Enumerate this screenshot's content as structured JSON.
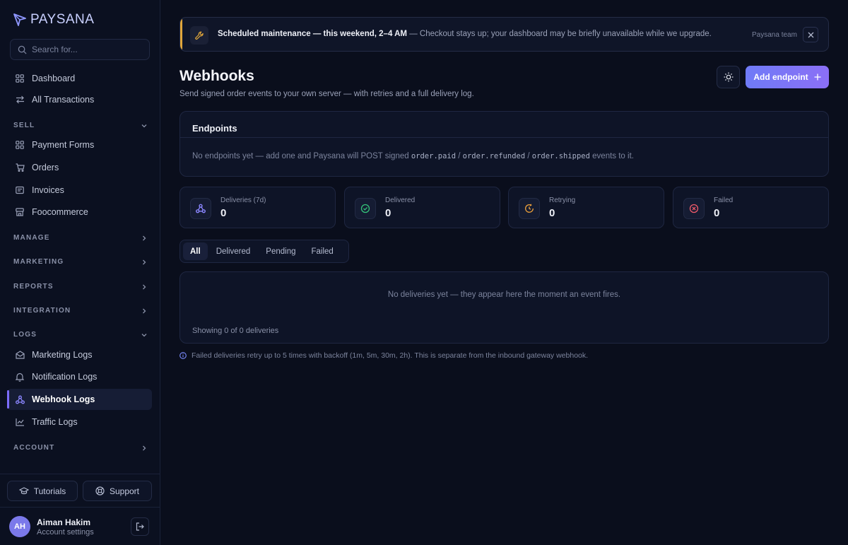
{
  "brand": {
    "name": "PAYSANA",
    "accent": "#7c6cff"
  },
  "search": {
    "placeholder": "Search for..."
  },
  "sidebar": {
    "top_items": [
      {
        "label": "Dashboard",
        "icon": "grid-icon"
      },
      {
        "label": "All Transactions",
        "icon": "arrows-swap-icon"
      }
    ],
    "sections": [
      {
        "title": "SELL",
        "expanded": true,
        "items": [
          {
            "label": "Payment Forms",
            "icon": "grid-icon"
          },
          {
            "label": "Orders",
            "icon": "cart-icon"
          },
          {
            "label": "Invoices",
            "icon": "invoice-icon"
          },
          {
            "label": "Foocommerce",
            "icon": "store-icon"
          }
        ]
      },
      {
        "title": "MANAGE",
        "expanded": false
      },
      {
        "title": "MARKETING",
        "expanded": false
      },
      {
        "title": "REPORTS",
        "expanded": false
      },
      {
        "title": "INTEGRATION",
        "expanded": false
      },
      {
        "title": "LOGS",
        "expanded": true,
        "items": [
          {
            "label": "Marketing Logs",
            "icon": "mail-icon"
          },
          {
            "label": "Notification Logs",
            "icon": "bell-icon"
          },
          {
            "label": "Webhook Logs",
            "icon": "webhook-icon",
            "active": true
          },
          {
            "label": "Traffic Logs",
            "icon": "chart-icon"
          }
        ]
      },
      {
        "title": "ACCOUNT",
        "expanded": false
      }
    ],
    "tutorials_label": "Tutorials",
    "support_label": "Support"
  },
  "user": {
    "initials": "AH",
    "name": "Aiman Hakim",
    "subtitle": "Account settings"
  },
  "banner": {
    "title": "Scheduled maintenance — this weekend, 2–4 AM",
    "message": " — Checkout stays up; your dashboard may be briefly unavailable while we upgrade.",
    "team": "Paysana team",
    "accent": "#e0a63a"
  },
  "page": {
    "title": "Webhooks",
    "subtitle": "Send signed order events to your own server — with retries and a full delivery log.",
    "add_label": "Add endpoint"
  },
  "endpoints": {
    "title": "Endpoints",
    "empty_pre": "No endpoints yet — add one and Paysana will POST signed ",
    "events": [
      "order.paid",
      "order.refunded",
      "order.shipped"
    ],
    "sep": " / ",
    "empty_post": " events to it."
  },
  "stats": [
    {
      "label": "Deliveries (7d)",
      "value": "0",
      "icon": "webhook-icon",
      "color": "#8b86ff"
    },
    {
      "label": "Delivered",
      "value": "0",
      "icon": "check-circle-icon",
      "color": "#34c37a"
    },
    {
      "label": "Retrying",
      "value": "0",
      "icon": "retry-icon",
      "color": "#f0a23a"
    },
    {
      "label": "Failed",
      "value": "0",
      "icon": "x-circle-icon",
      "color": "#ef5a6a"
    }
  ],
  "tabs": [
    {
      "label": "All",
      "active": true
    },
    {
      "label": "Delivered"
    },
    {
      "label": "Pending"
    },
    {
      "label": "Failed"
    }
  ],
  "deliveries": {
    "empty": "No deliveries yet — they appear here the moment an event fires.",
    "count": "Showing 0 of 0 deliveries"
  },
  "footnote": "Failed deliveries retry up to 5 times with backoff (1m, 5m, 30m, 2h). This is separate from the inbound gateway webhook."
}
